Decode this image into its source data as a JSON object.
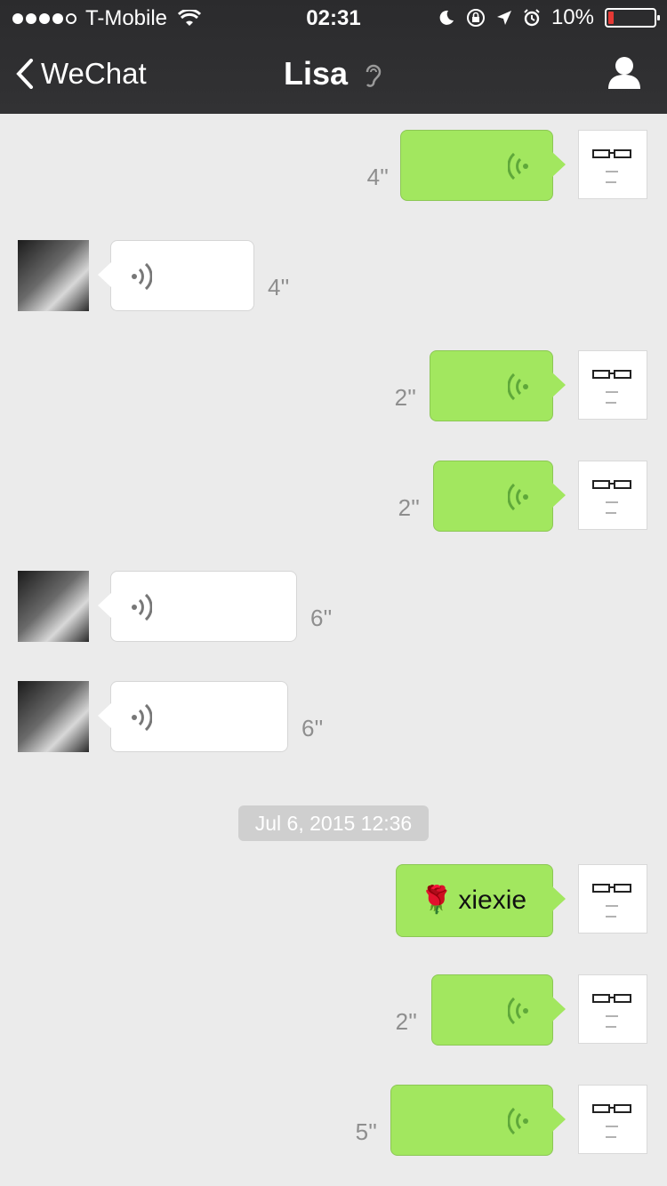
{
  "status": {
    "carrier": "T-Mobile",
    "time": "02:31",
    "battery": "10%"
  },
  "nav": {
    "back_label": "WeChat",
    "title": "Lisa"
  },
  "timestamp": "Jul 6, 2015 12:36",
  "messages": [
    {
      "sender": "me",
      "type": "voice",
      "duration": "4''"
    },
    {
      "sender": "Lisa",
      "type": "voice",
      "duration": "4''"
    },
    {
      "sender": "me",
      "type": "voice",
      "duration": "2''"
    },
    {
      "sender": "me",
      "type": "voice",
      "duration": "2''"
    },
    {
      "sender": "Lisa",
      "type": "voice",
      "duration": "6''"
    },
    {
      "sender": "Lisa",
      "type": "voice",
      "duration": "6''"
    },
    {
      "sender": "me",
      "type": "text",
      "text": "xiexie"
    },
    {
      "sender": "me",
      "type": "voice",
      "duration": "2''"
    },
    {
      "sender": "me",
      "type": "voice",
      "duration": "5''"
    }
  ],
  "colors": {
    "my_bubble": "#a2e75f",
    "their_bubble": "#ffffff",
    "header": "#2f2f31",
    "background": "#ebebeb"
  }
}
